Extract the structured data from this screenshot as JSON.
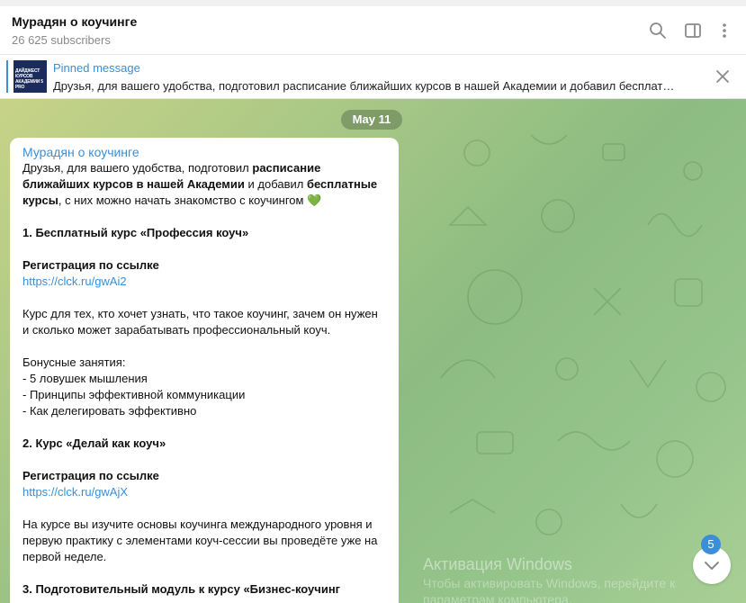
{
  "header": {
    "title": "Мурадян о коучинге",
    "subscribers": "26 625 subscribers"
  },
  "pinned": {
    "label": "Pinned message",
    "text": "Друзья, для вашего удобства, подготовил расписание ближайших курсов в нашей Академии и добавил бесплат…",
    "thumb_text": "ДАЙДЖЕСТ КУРСОВ АКАДЕМИИ 5 PRO"
  },
  "chat": {
    "date": "May 11",
    "sender": "Мурадян о коучинге",
    "intro": {
      "t1": "Друзья, для вашего удобства, подготовил ",
      "b1": "расписание ближайших курсов в нашей Академии",
      "t2": " и добавил ",
      "b2": "бесплатные курсы",
      "t3": ", с них можно начать знакомство с коучингом 💚"
    },
    "course1_title": "1. Бесплатный курс «Профессия коуч»",
    "reg1": "Регистрация по ссылке",
    "link1": "https://clck.ru/gwAi2",
    "desc1": "Курс для тех, кто хочет узнать, что такое коучинг, зачем он нужен и сколько может зарабатывать профессиональный коуч.",
    "bonus_title": "Бонусные занятия:",
    "bonus_items": [
      "- 5 ловушек мышления",
      "- Принципы эффективной коммуникации",
      "- Как делегировать эффективно"
    ],
    "course2_title": "2. Курс «Делай как коуч»",
    "reg2": "Регистрация по ссылке",
    "link2": "https://clck.ru/gwAjX",
    "desc2": "На курсе вы изучите основы коучинга международного уровня и первую практику с элементами коуч-сессии вы проведёте уже на первой неделе.",
    "course3_title": "3. Подготовительный модуль к курсу «Бизнес-коучинг"
  },
  "watermark": {
    "line1": "Активация Windows",
    "line2": "Чтобы активировать Windows, перейдите к",
    "line3": "параметрам компьютера."
  },
  "scroll": {
    "unread_count": "5"
  },
  "colors": {
    "accent": "#3a8fd6"
  }
}
